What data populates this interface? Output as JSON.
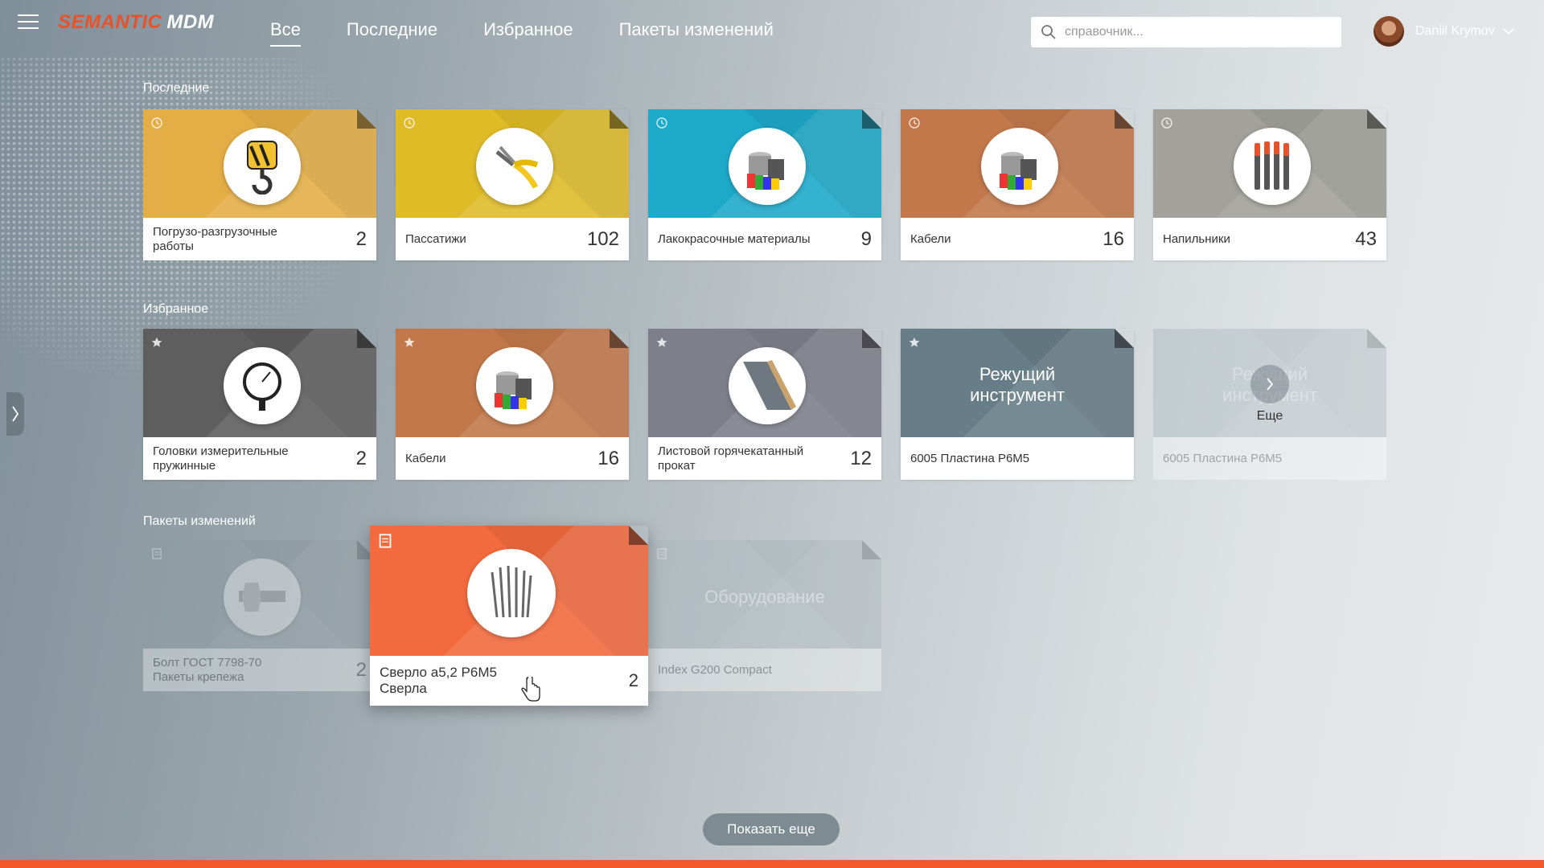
{
  "app": {
    "logo_part1": "SEMANTIC",
    "logo_part2": "MDM"
  },
  "nav": {
    "tabs": [
      "Все",
      "Последние",
      "Избранное",
      "Пакеты изменений"
    ],
    "active": 0
  },
  "search": {
    "placeholder": "справочник..."
  },
  "user": {
    "name": "Daniil Krymov"
  },
  "sections": {
    "recent": {
      "title": "Последние",
      "cards": [
        {
          "name": "Погрузо-разгрузочные работы",
          "count": "2",
          "color": "#e3ae45",
          "icon": "crane-hook-icon"
        },
        {
          "name": "Пассатижи",
          "count": "102",
          "color": "#dfbb28",
          "icon": "pliers-icon"
        },
        {
          "name": "Лакокрасочные материалы",
          "count": "9",
          "color": "#1da9c9",
          "icon": "paint-cans-icon"
        },
        {
          "name": "Кабели",
          "count": "16",
          "color": "#c2784a",
          "icon": "paint-cans-icon"
        },
        {
          "name": "Напильники",
          "count": "43",
          "color": "#a2a19b",
          "icon": "files-icon"
        }
      ]
    },
    "favorites": {
      "title": "Избранное",
      "cards": [
        {
          "name": "Головки измерительные пружинные",
          "count": "2",
          "color": "#5e5e5e",
          "icon": "gauge-icon"
        },
        {
          "name": "Кабели",
          "count": "16",
          "color": "#c2784a",
          "icon": "paint-cans-icon"
        },
        {
          "name": "Листовой горячекатанный прокат",
          "count": "12",
          "color": "#7e7f8b",
          "icon": "sheet-metal-icon"
        },
        {
          "name": "6005 Пластина Р6М5",
          "count": "",
          "color": "#677d87",
          "big_text": "Режущий инструмент"
        },
        {
          "name": "6005 Пластина Р6М5",
          "count": "",
          "color": "#9fb0b8",
          "big_text": "Режущий инструмент",
          "more_label": "Еще"
        }
      ]
    },
    "packages": {
      "title": "Пакеты изменений",
      "cards": [
        {
          "name": "Болт ГОСТ 7798-70",
          "subname": "Пакеты крепежа",
          "count": "2",
          "color": "#8e9ca2",
          "icon": "bolt-icon"
        },
        {
          "name": "Сверло а5,2 Р6М5",
          "subname": "Сверла",
          "count": "2",
          "color": "#f26a3d",
          "icon": "drills-icon"
        },
        {
          "name": "Index G200 Compact",
          "subname": "",
          "count": "",
          "color": "#a7b5bb",
          "big_text": "Оборудование"
        }
      ]
    }
  },
  "show_more_label": "Показать еще",
  "accent_color": "#f1592a"
}
